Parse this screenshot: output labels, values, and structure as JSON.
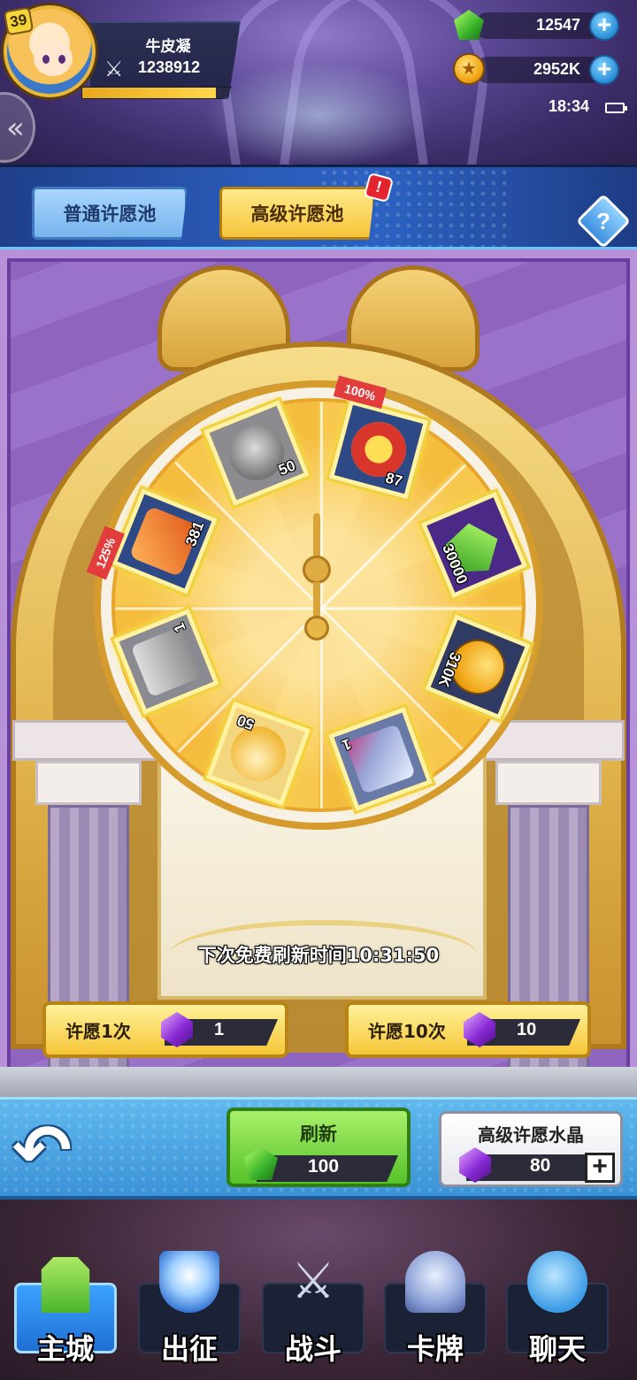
{
  "player": {
    "level": "39",
    "name": "牛皮凝",
    "power": "1238912",
    "exp_progress": 0.9
  },
  "resources": {
    "gems": "12547",
    "gold": "2952K"
  },
  "status_bar": {
    "time": "18:34"
  },
  "tabs": {
    "normal": "普通许愿池",
    "advanced": "高级许愿池",
    "advanced_alert": "!",
    "help": "?"
  },
  "wheel": {
    "items": [
      {
        "qty": "50",
        "icon": "gray-hero-card",
        "ribbon": ""
      },
      {
        "qty": "87",
        "icon": "red-emblem-coin",
        "ribbon": "100%"
      },
      {
        "qty": "30000",
        "icon": "green-gem",
        "ribbon": ""
      },
      {
        "qty": "310K",
        "icon": "gold-coin",
        "ribbon": ""
      },
      {
        "qty": "1",
        "icon": "crystal-chest",
        "ribbon": ""
      },
      {
        "qty": "50",
        "icon": "golden-hero-card",
        "ribbon": ""
      },
      {
        "qty": "1",
        "icon": "gray-armor",
        "ribbon": ""
      },
      {
        "qty": "381",
        "icon": "orange-rune",
        "ribbon": "125%"
      }
    ],
    "next_free_refresh": "下次免费刷新时间10:31:50"
  },
  "wish": {
    "once_label": "许愿1次",
    "once_cost": "1",
    "ten_label": "许愿10次",
    "ten_cost": "10"
  },
  "controls": {
    "refresh_label": "刷新",
    "refresh_cost": "100",
    "crystal_label": "高级许愿水晶",
    "crystal_count": "80"
  },
  "nav": {
    "home": "主城",
    "expedition": "出征",
    "battle": "战斗",
    "cards": "卡牌",
    "chat": "聊天"
  },
  "colors": {
    "gold_button": "#f5c637",
    "green_button": "#55c22b",
    "tab_blue": "#2a5bb8",
    "stage_purple": "#9a72c9"
  }
}
